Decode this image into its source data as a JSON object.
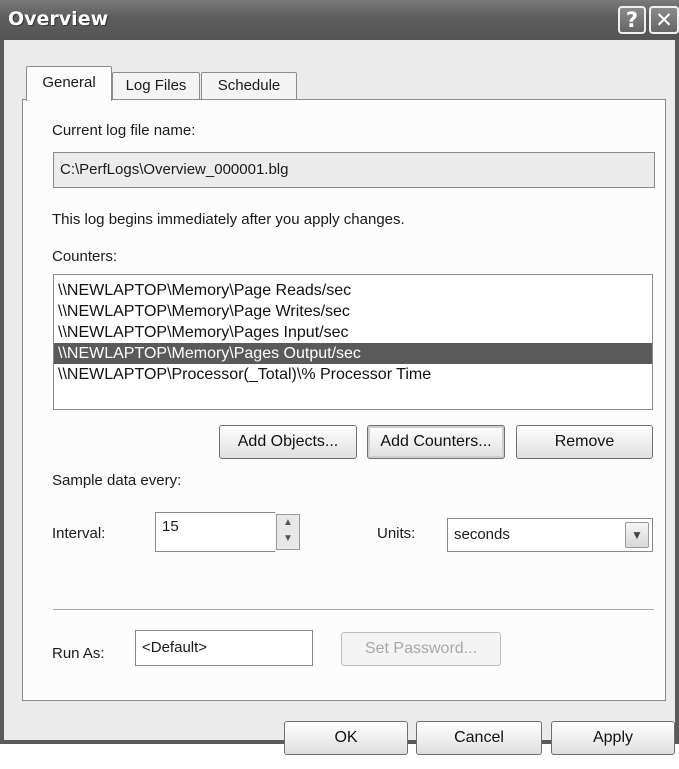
{
  "window": {
    "title": "Overview",
    "help_glyph": "?",
    "close_glyph": "✕"
  },
  "tabs": [
    {
      "label": "General"
    },
    {
      "label": "Log Files"
    },
    {
      "label": "Schedule"
    }
  ],
  "general": {
    "current_log_label": "Current log file name:",
    "current_log_value": "C:\\PerfLogs\\Overview_000001.blg",
    "begins_text": "This log begins immediately after you apply changes.",
    "counters_label": "Counters:",
    "counters": [
      "\\\\NEWLAPTOP\\Memory\\Page Reads/sec",
      "\\\\NEWLAPTOP\\Memory\\Page Writes/sec",
      "\\\\NEWLAPTOP\\Memory\\Pages Input/sec",
      "\\\\NEWLAPTOP\\Memory\\Pages Output/sec",
      "\\\\NEWLAPTOP\\Processor(_Total)\\% Processor Time"
    ],
    "selected_counter_index": 3,
    "add_objects_label": "Add Objects...",
    "add_counters_label": "Add Counters...",
    "remove_label": "Remove",
    "sample_label": "Sample data every:",
    "interval_label": "Interval:",
    "interval_value": "15",
    "units_label": "Units:",
    "units_value": "seconds",
    "run_as_label": "Run As:",
    "run_as_value": "<Default>",
    "set_password_label": "Set Password..."
  },
  "footer": {
    "ok_label": "OK",
    "cancel_label": "Cancel",
    "apply_label": "Apply"
  },
  "colors": {
    "titlebar": "#5c5c5c",
    "selection": "#5a5a5a",
    "dialog_bg": "#ebebeb"
  }
}
